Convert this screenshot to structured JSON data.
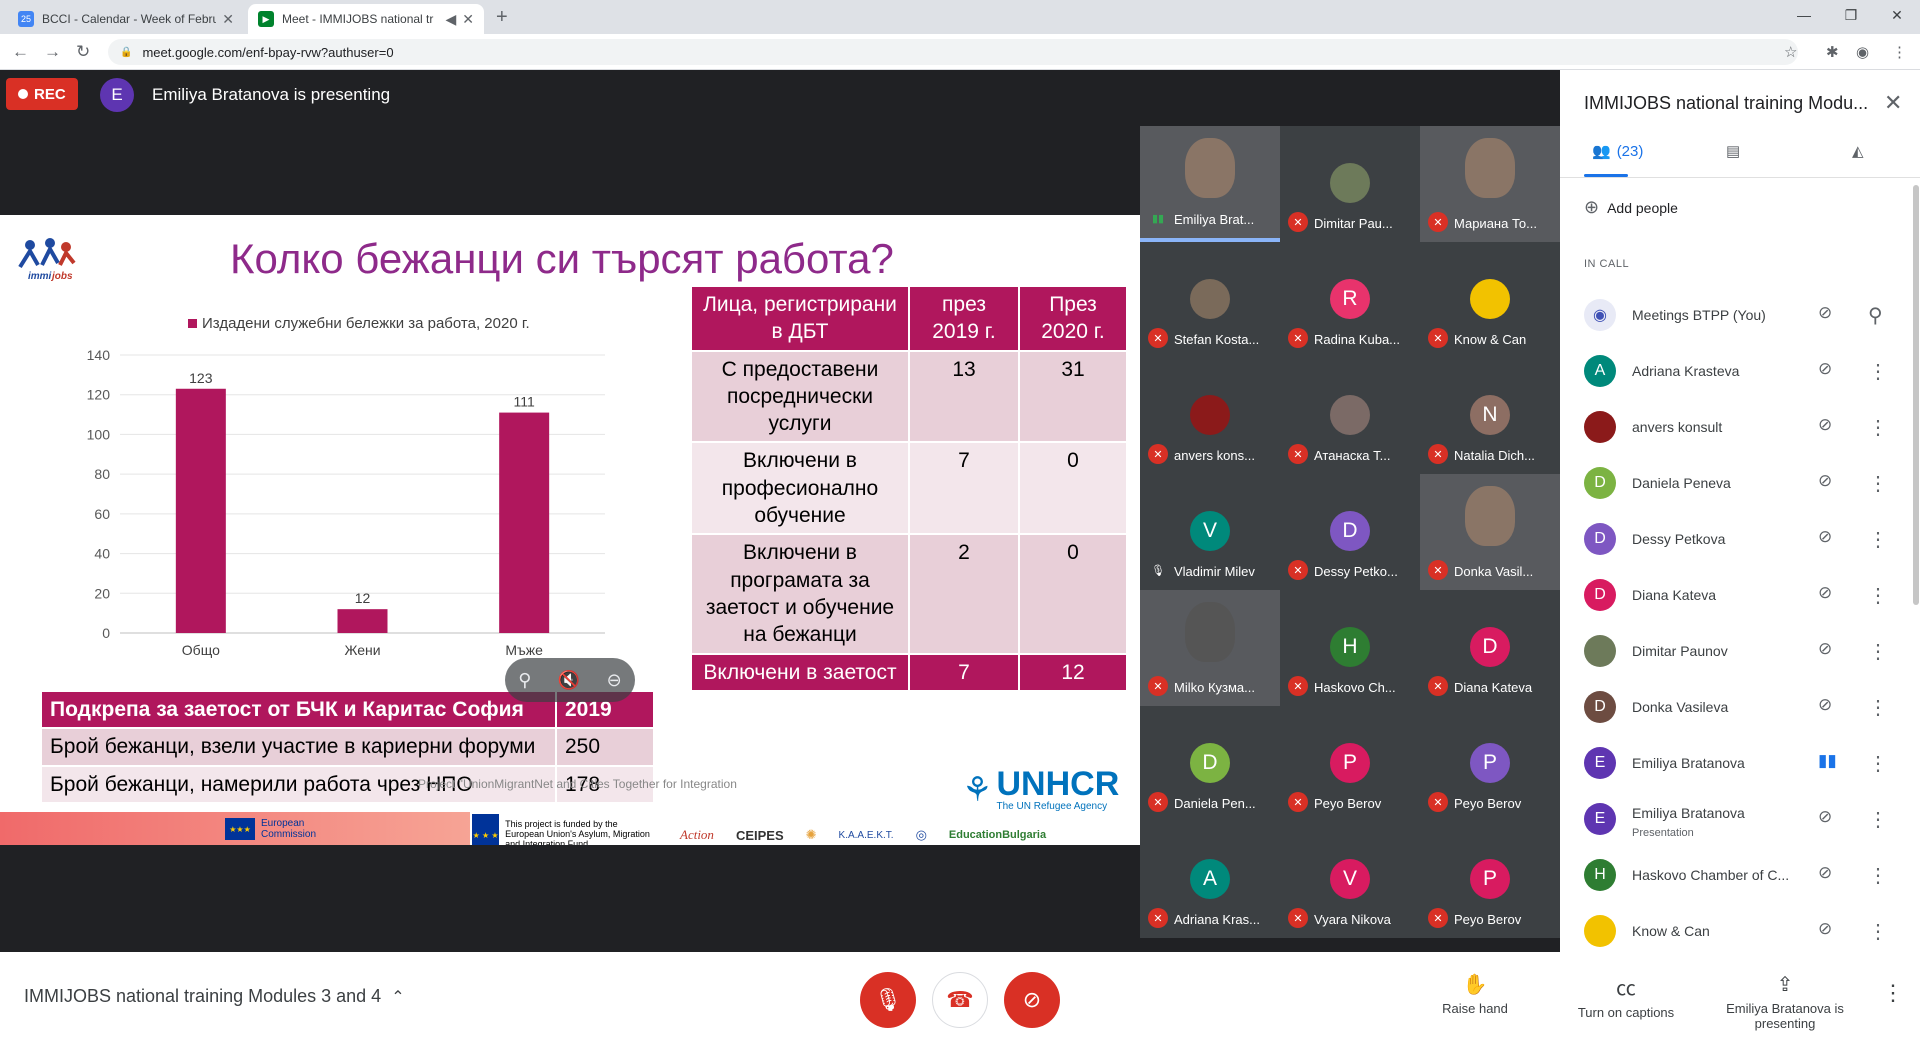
{
  "browser": {
    "tabs": [
      {
        "title": "BCCI - Calendar - Week of Februa",
        "favicon": "calendar-icon"
      },
      {
        "title": "Meet - IMMIJOBS national tr",
        "favicon": "meet-icon"
      }
    ],
    "url": "meet.google.com/enf-bpay-rvw?authuser=0"
  },
  "meet": {
    "rec_label": "REC",
    "presenter_initial": "E",
    "presenter_text": "Emiliya Bratanova is presenting"
  },
  "slide": {
    "title": "Колко бежанци си търсят работа?",
    "logo_text": "immijobs",
    "legend": "Издадени служебни бележки за работа, 2020 г.",
    "table1": {
      "header": [
        "Подкрепа за заетост от БЧК и Каритас София",
        "2019"
      ],
      "rows": [
        [
          "Брой бежанци, взели участие в кариерни форуми",
          "250"
        ],
        [
          "Брой бежанци, намерили работа чрез НПО",
          "178"
        ]
      ]
    },
    "table2": {
      "header": [
        "Лица, регистрирани в ДБТ",
        "през 2019 г.",
        "През 2020 г."
      ],
      "rows": [
        [
          "С предоставени посреднически услуги",
          "13",
          "31"
        ],
        [
          "Включени в професионално обучение",
          "7",
          "0"
        ],
        [
          "Включени в програмата за заетост и обучение на бежанци",
          "2",
          "0"
        ],
        [
          "Включени в заетост",
          "7",
          "12"
        ]
      ]
    },
    "footnote": "Project \"UnionMigrantNet and Cities Together for Integration",
    "unhcr": "UNHCR",
    "unhcr_sub": "The UN Refugee Agency",
    "eu_commission": "European Commission",
    "fund_text": "This project is funded by the European Union's Asylum, Migration and Integration Fund",
    "partners": [
      "Action",
      "CEIPES",
      "K.A.A.E.K.T.",
      "EducationBulgaria"
    ]
  },
  "chart_data": {
    "type": "bar",
    "categories": [
      "Общо",
      "Жени",
      "Мъже"
    ],
    "series": [
      {
        "name": "Издадени служебни бележки за работа, 2020 г.",
        "values": [
          123,
          12,
          111
        ]
      }
    ],
    "ylim": [
      0,
      140
    ],
    "yticks": [
      0,
      20,
      40,
      60,
      80,
      100,
      120,
      140
    ],
    "color": "#b0175d",
    "legend_position": "top"
  },
  "tiles": [
    {
      "name": "Emiliya Brat...",
      "initial": "",
      "color": "#585a5e",
      "video": true,
      "muted": false
    },
    {
      "name": "Dimitar Pau...",
      "initial": "",
      "color": "#6d7a5a",
      "video": false,
      "muted": true
    },
    {
      "name": "Мариана То...",
      "initial": "",
      "color": "#585a5e",
      "video": true,
      "muted": true
    },
    {
      "name": "Stefan Kosta...",
      "initial": "",
      "color": "#7a6a5a",
      "video": false,
      "muted": true
    },
    {
      "name": "Radina Kuba...",
      "initial": "R",
      "color": "#e8336c",
      "video": false,
      "muted": true
    },
    {
      "name": "Know & Can",
      "initial": "",
      "color": "#f2c200",
      "video": false,
      "muted": true
    },
    {
      "name": "anvers kons...",
      "initial": "",
      "color": "#8b1a1a",
      "video": false,
      "muted": true
    },
    {
      "name": "Атанаска Т...",
      "initial": "",
      "color": "#7b6a66",
      "video": false,
      "muted": true
    },
    {
      "name": "Natalia Dich...",
      "initial": "N",
      "color": "#8d6e63",
      "video": false,
      "muted": true
    },
    {
      "name": "Vladimir Milev",
      "initial": "V",
      "color": "#00897b",
      "video": false,
      "muted": false
    },
    {
      "name": "Dessy Petko...",
      "initial": "D",
      "color": "#7e57c2",
      "video": false,
      "muted": true
    },
    {
      "name": "Donka Vasil...",
      "initial": "",
      "color": "#585a5e",
      "video": true,
      "muted": true
    },
    {
      "name": "Milko Кузма...",
      "initial": "",
      "color": "#4a4a4a",
      "video": true,
      "muted": true
    },
    {
      "name": "Haskovo Ch...",
      "initial": "H",
      "color": "#2e7d32",
      "video": false,
      "muted": true
    },
    {
      "name": "Diana Kateva",
      "initial": "D",
      "color": "#d81b60",
      "video": false,
      "muted": true
    },
    {
      "name": "Daniela Pen...",
      "initial": "D",
      "color": "#7cb342",
      "video": false,
      "muted": true
    },
    {
      "name": "Peyo Berov",
      "initial": "P",
      "color": "#d81b60",
      "video": false,
      "muted": true
    },
    {
      "name": "Peyo Berov",
      "initial": "P",
      "color": "#7e57c2",
      "video": false,
      "muted": true
    },
    {
      "name": "Adriana Kras...",
      "initial": "A",
      "color": "#00897b",
      "video": false,
      "muted": true
    },
    {
      "name": "Vyara Nikova",
      "initial": "V",
      "color": "#d81b60",
      "video": false,
      "muted": true
    },
    {
      "name": "Peyo Berov",
      "initial": "P",
      "color": "#d81b60",
      "video": false,
      "muted": true
    }
  ],
  "panel": {
    "title": "IMMIJOBS national training Modu...",
    "people_count": "(23)",
    "add_people": "Add people",
    "in_call": "IN CALL",
    "people": [
      {
        "name": "Meetings BTPP (You)",
        "initial": "",
        "color": "#e8eaf6",
        "sub": ""
      },
      {
        "name": "Adriana Krasteva",
        "initial": "A",
        "color": "#00897b",
        "sub": ""
      },
      {
        "name": "anvers konsult",
        "initial": "",
        "color": "#8b1a1a",
        "sub": ""
      },
      {
        "name": "Daniela Peneva",
        "initial": "D",
        "color": "#7cb342",
        "sub": ""
      },
      {
        "name": "Dessy Petkova",
        "initial": "D",
        "color": "#7e57c2",
        "sub": ""
      },
      {
        "name": "Diana Kateva",
        "initial": "D",
        "color": "#d81b60",
        "sub": ""
      },
      {
        "name": "Dimitar Paunov",
        "initial": "",
        "color": "#6d7a5a",
        "sub": ""
      },
      {
        "name": "Donka Vasileva",
        "initial": "D",
        "color": "#6d4c41",
        "sub": ""
      },
      {
        "name": "Emiliya Bratanova",
        "initial": "E",
        "color": "#5e35b1",
        "sub": ""
      },
      {
        "name": "Emiliya Bratanova",
        "initial": "E",
        "color": "#5e35b1",
        "sub": "Presentation"
      },
      {
        "name": "Haskovo Chamber of C...",
        "initial": "H",
        "color": "#2e7d32",
        "sub": ""
      },
      {
        "name": "Know & Can",
        "initial": "",
        "color": "#f2c200",
        "sub": ""
      }
    ]
  },
  "bottom": {
    "meeting_title": "IMMIJOBS national training Modules 3 and 4",
    "raise_hand": "Raise hand",
    "captions": "Turn on captions",
    "presenting": "Emiliya Bratanova is presenting"
  }
}
